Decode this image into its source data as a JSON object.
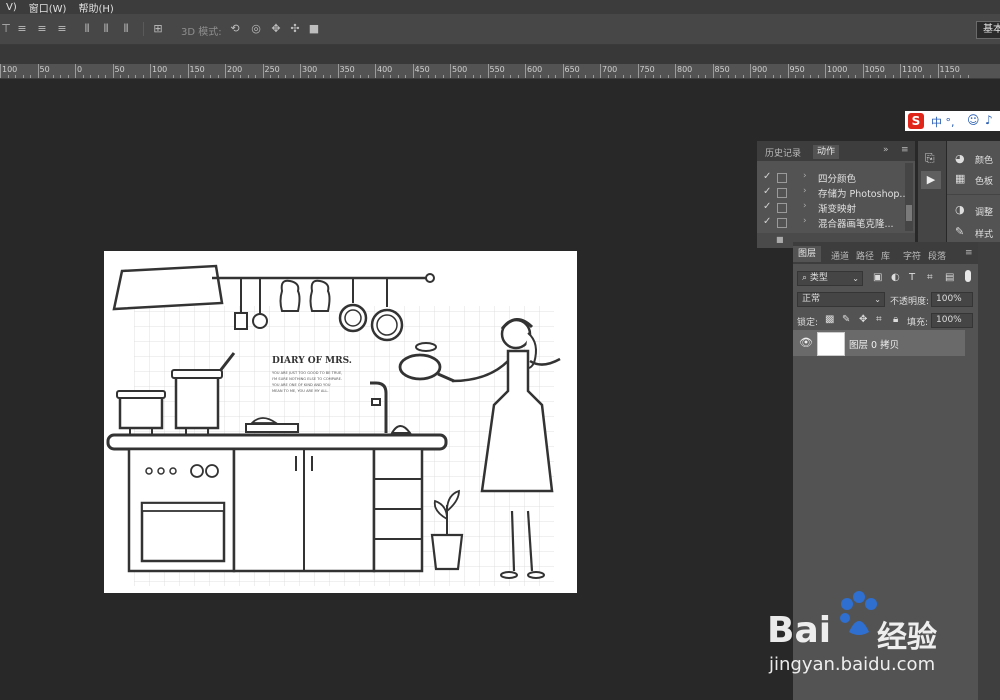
{
  "menu": [
    "V)",
    "窗口(W)",
    "帮助(H)"
  ],
  "options": {
    "mode_3d_label": "3D 模式:",
    "workspace": "基本"
  },
  "ruler": {
    "labels": [
      "100",
      "50",
      "0",
      "50",
      "100",
      "150",
      "200",
      "250",
      "300",
      "350",
      "400",
      "450",
      "500",
      "550",
      "600",
      "650",
      "700",
      "750",
      "800",
      "850",
      "900",
      "950",
      "1000",
      "1050",
      "1100",
      "1150"
    ]
  },
  "canvas_text": {
    "title": "DIARY  OF MRS.",
    "lines": [
      "YOU ARE JUST TOO GOOD TO BE TRUE,",
      "I'M SURE NOTHING ELSE TO COMPARE.",
      "YOU ARE ONE OF KIND AND YOU",
      "MEAN TO ME, YOU ARE MY ALL."
    ]
  },
  "history_panel": {
    "tabs": [
      "历史记录",
      "动作"
    ],
    "actions": [
      {
        "checked": true,
        "label": "四分颜色"
      },
      {
        "checked": true,
        "label": "存储为 Photoshop..."
      },
      {
        "checked": true,
        "label": "渐变映射"
      },
      {
        "checked": true,
        "label": "混合器画笔克隆..."
      }
    ]
  },
  "side_panel": {
    "items": [
      "颜色",
      "色板",
      "调整",
      "样式"
    ]
  },
  "layers_panel": {
    "tabs": [
      "图层",
      "通道",
      "路径",
      "库",
      "字符",
      "段落"
    ],
    "filter_kind": "类型",
    "blend_mode": "正常",
    "opacity_label": "不透明度:",
    "opacity_value": "100%",
    "lock_label": "锁定:",
    "fill_label": "填充:",
    "fill_value": "100%",
    "layers": [
      {
        "name": "图层 0 拷贝",
        "visible": true
      }
    ]
  },
  "ime": {
    "text": "中 °,"
  },
  "watermark": {
    "brand_a": "Bai",
    "brand_b": "经验",
    "url": "jingyan.baidu.com"
  },
  "colors": {
    "app_bg": "#282828",
    "panel": "#535353",
    "accent_red": "#e0261a",
    "paw_blue": "#2f6fd0"
  }
}
